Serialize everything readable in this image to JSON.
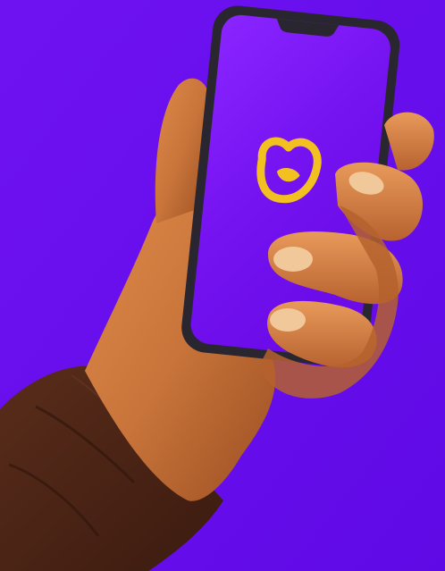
{
  "scene": {
    "background_color": "#6a0df0",
    "subject": "hand-holding-smartphone",
    "phone": {
      "screen_color": "#7b12ee",
      "frame_color": "#2a2630",
      "app_logo": {
        "icon": "heart-smile-logo-icon",
        "color": "#f2c021"
      }
    },
    "hand": {
      "skin_color": "#c8743a",
      "sleeve_color": "#4a2416"
    }
  }
}
